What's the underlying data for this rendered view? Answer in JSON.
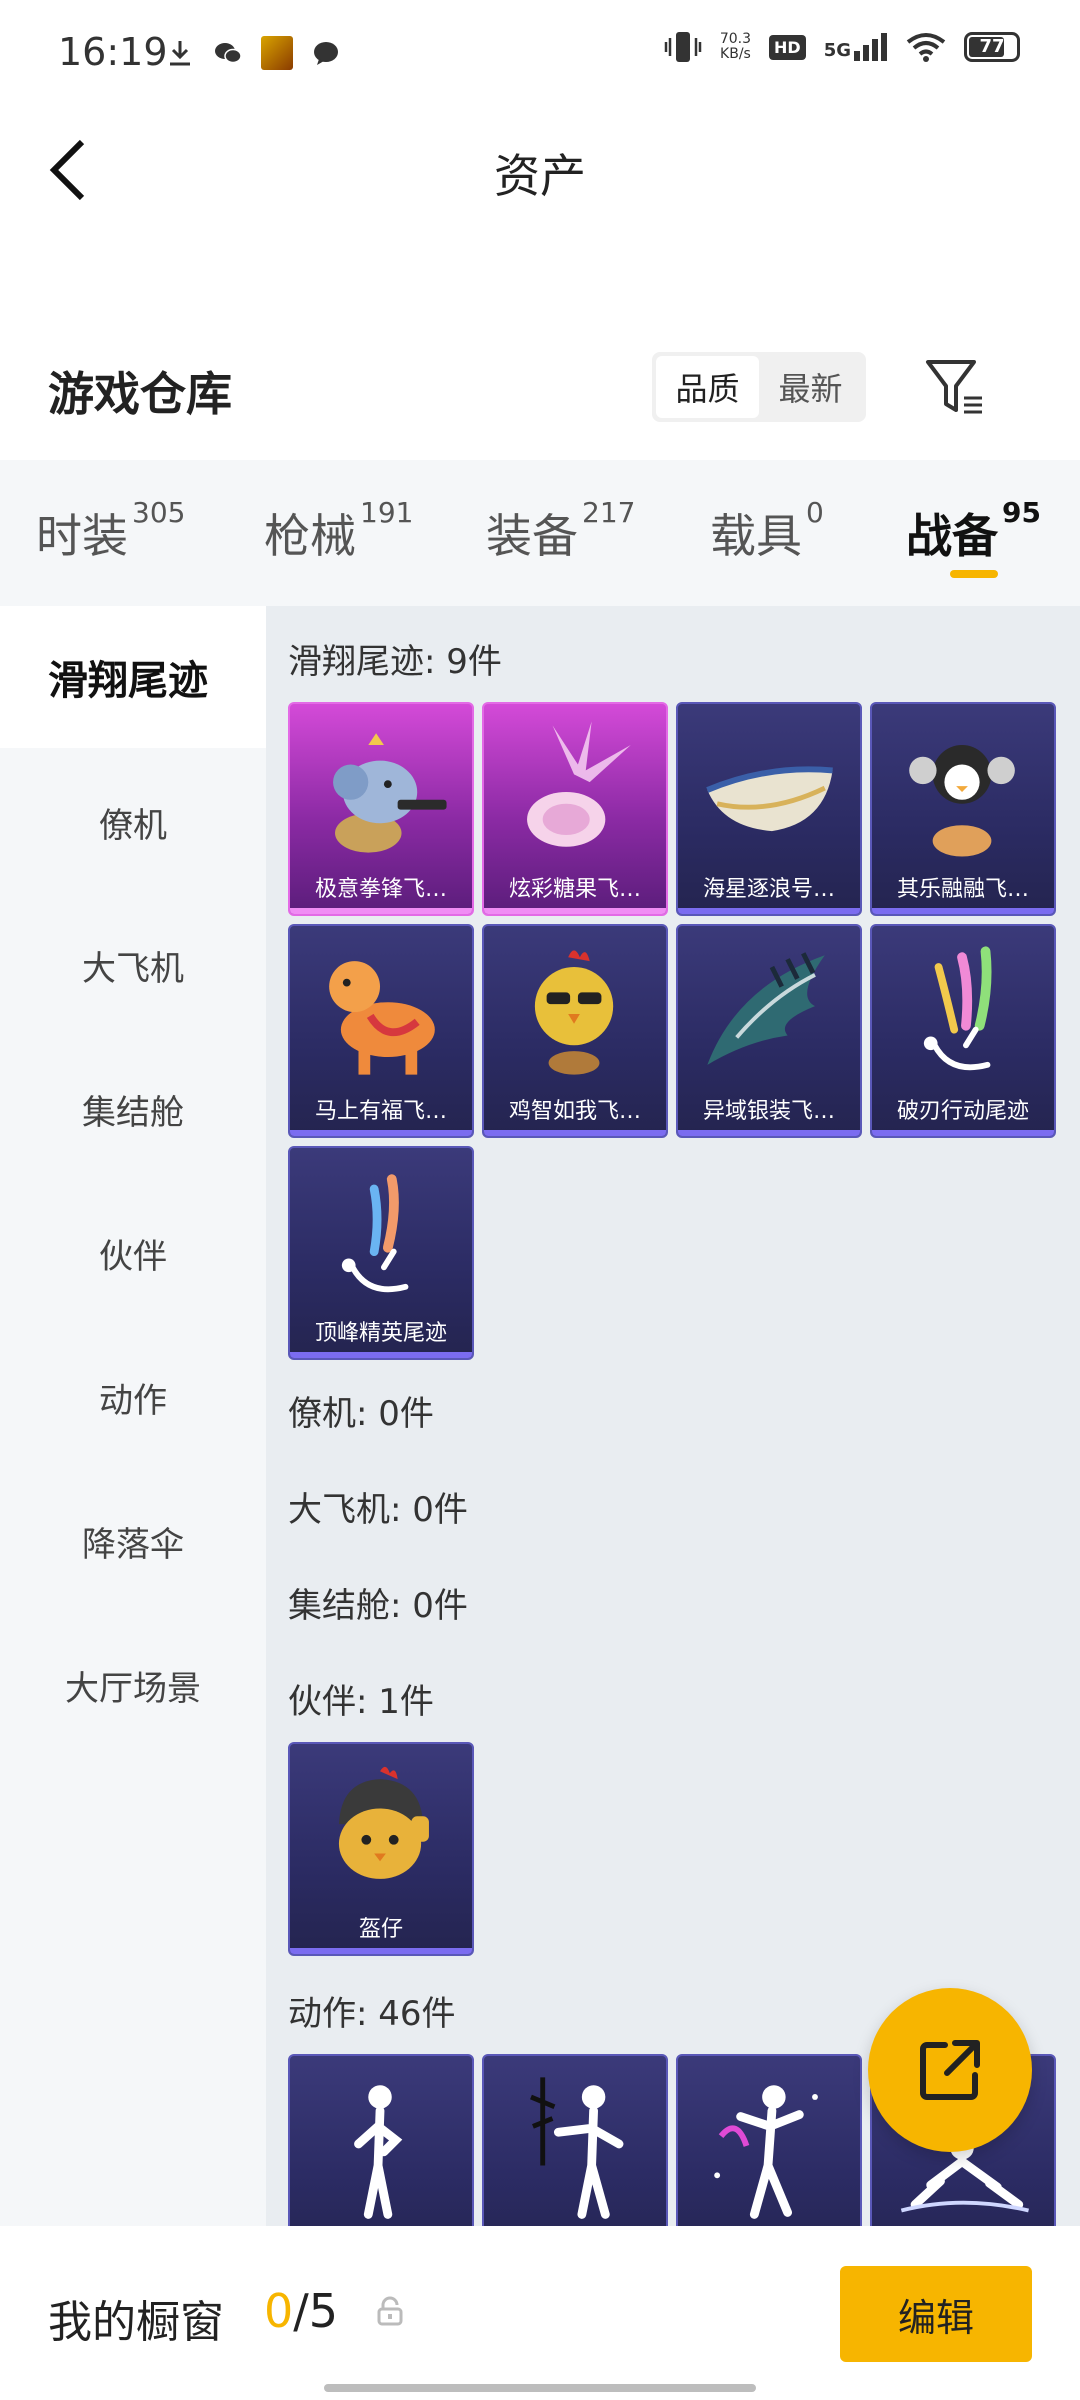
{
  "status_bar": {
    "time": "16:19",
    "net_speed_value": "70.3",
    "net_speed_unit": "KB/s",
    "hd_label": "HD",
    "signal_label": "5G",
    "battery_level": "77"
  },
  "header": {
    "title": "资产"
  },
  "warehouse": {
    "title": "游戏仓库",
    "sort_options": [
      "品质",
      "最新"
    ],
    "active_sort": "品质"
  },
  "tabs": [
    {
      "label": "时装",
      "count": "305"
    },
    {
      "label": "枪械",
      "count": "191"
    },
    {
      "label": "装备",
      "count": "217"
    },
    {
      "label": "载具",
      "count": "0"
    },
    {
      "label": "战备",
      "count": "95",
      "active": true
    }
  ],
  "sidebar": [
    {
      "label": "滑翔尾迹",
      "active": true
    },
    {
      "label": "僚机"
    },
    {
      "label": "大飞机"
    },
    {
      "label": "集结舱"
    },
    {
      "label": "伙伴"
    },
    {
      "label": "动作"
    },
    {
      "label": "降落伞"
    },
    {
      "label": "大厅场景"
    }
  ],
  "sections": {
    "glide_trail": {
      "header": "滑翔尾迹: 9件",
      "items": [
        {
          "name": "极意拳锋飞…",
          "rarity": "pink",
          "icon": "elephant-toy-icon"
        },
        {
          "name": "炫彩糖果飞…",
          "rarity": "pink",
          "icon": "candy-wrapper-icon"
        },
        {
          "name": "海星逐浪号…",
          "rarity": "purple",
          "icon": "boat-icon"
        },
        {
          "name": "其乐融融飞…",
          "rarity": "purple",
          "icon": "penguin-toy-icon"
        },
        {
          "name": "马上有福飞…",
          "rarity": "purple",
          "icon": "toy-horse-icon"
        },
        {
          "name": "鸡智如我飞…",
          "rarity": "purple",
          "icon": "rooster-icon"
        },
        {
          "name": "异域银装飞…",
          "rarity": "purple",
          "icon": "glider-wing-icon"
        },
        {
          "name": "破刃行动尾迹",
          "rarity": "purple",
          "icon": "skydiver-trail-icon"
        },
        {
          "name": "顶峰精英尾迹",
          "rarity": "purple",
          "icon": "skydiver-trail-icon"
        }
      ]
    },
    "wingman": {
      "header": "僚机: 0件"
    },
    "big_plane": {
      "header": "大飞机: 0件"
    },
    "pod": {
      "header": "集结舱: 0件"
    },
    "companion": {
      "header": "伙伴: 1件",
      "items": [
        {
          "name": "盔仔",
          "rarity": "purple",
          "icon": "helmet-chick-icon"
        }
      ]
    },
    "emote": {
      "header": "动作: 46件",
      "items": [
        {
          "name": "",
          "rarity": "purple",
          "icon": "pose-figure-icon"
        },
        {
          "name": "",
          "rarity": "purple",
          "icon": "pose-figure-icon"
        },
        {
          "name": "",
          "rarity": "purple",
          "icon": "dance-figure-icon"
        },
        {
          "name": "",
          "rarity": "purple",
          "icon": "crouch-figure-icon"
        }
      ]
    }
  },
  "showcase": {
    "title": "我的橱窗",
    "current": "0",
    "total": "/5",
    "edit_label": "编辑"
  },
  "colors": {
    "accent": "#f7b500",
    "card_purple": "#2b2b63",
    "card_pink": "#c23ccc",
    "sidebar_bg": "#f5f7f9",
    "content_bg": "#e9edf1"
  }
}
